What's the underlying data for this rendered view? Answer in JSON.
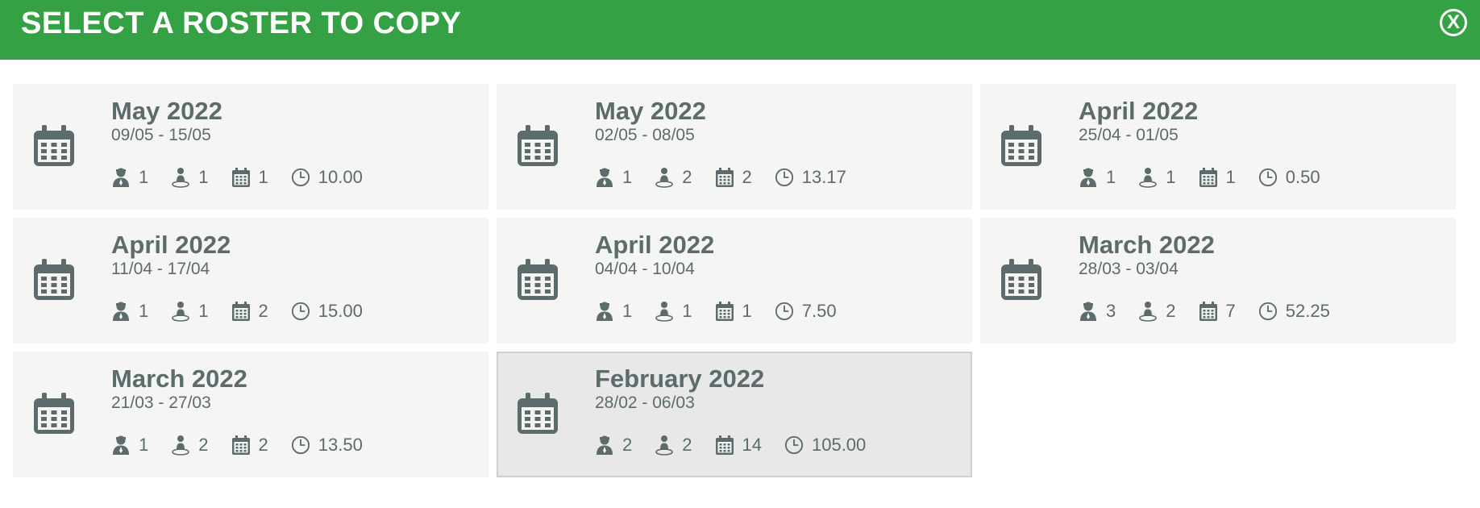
{
  "header": {
    "title": "SELECT A ROSTER TO COPY",
    "close_label": "X"
  },
  "icons": {
    "card": "calendar-icon",
    "staff": "person-icon",
    "location": "person-location-icon",
    "shifts": "calendar-grid-icon",
    "hours": "clock-icon"
  },
  "colors": {
    "header_bg": "#34a244",
    "card_bg": "#f5f5f4",
    "selected_card_bg": "#e8e8e8",
    "text": "#5c6b6b"
  },
  "rosters": [
    {
      "month": "May 2022",
      "range": "09/05 - 15/05",
      "staff": "1",
      "locations": "1",
      "shifts": "1",
      "hours": "10.00",
      "selected": false
    },
    {
      "month": "May 2022",
      "range": "02/05 - 08/05",
      "staff": "1",
      "locations": "2",
      "shifts": "2",
      "hours": "13.17",
      "selected": false
    },
    {
      "month": "April 2022",
      "range": "25/04 - 01/05",
      "staff": "1",
      "locations": "1",
      "shifts": "1",
      "hours": "0.50",
      "selected": false
    },
    {
      "month": "April 2022",
      "range": "11/04 - 17/04",
      "staff": "1",
      "locations": "1",
      "shifts": "2",
      "hours": "15.00",
      "selected": false
    },
    {
      "month": "April 2022",
      "range": "04/04 - 10/04",
      "staff": "1",
      "locations": "1",
      "shifts": "1",
      "hours": "7.50",
      "selected": false
    },
    {
      "month": "March 2022",
      "range": "28/03 - 03/04",
      "staff": "3",
      "locations": "2",
      "shifts": "7",
      "hours": "52.25",
      "selected": false
    },
    {
      "month": "March 2022",
      "range": "21/03 - 27/03",
      "staff": "1",
      "locations": "2",
      "shifts": "2",
      "hours": "13.50",
      "selected": false
    },
    {
      "month": "February 2022",
      "range": "28/02 - 06/03",
      "staff": "2",
      "locations": "2",
      "shifts": "14",
      "hours": "105.00",
      "selected": true
    }
  ]
}
